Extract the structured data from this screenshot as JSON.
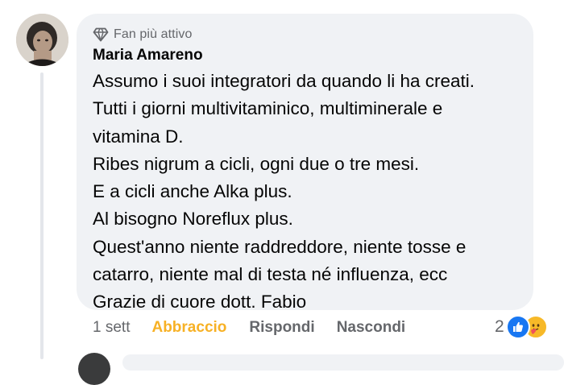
{
  "comment": {
    "badge": {
      "icon": "diamond-icon",
      "label": "Fan più attivo"
    },
    "author": "Maria Amareno",
    "avatar_icon": "user-photo-avatar",
    "lines": [
      "Assumo i suoi integratori da quando li ha creati.",
      "Tutti i giorni multivitaminico, multiminerale e",
      "vitamina D.",
      "Ribes nigrum a cicli, ogni due o tre mesi.",
      "E a cicli anche Alka plus.",
      "Al bisogno Noreflux plus.",
      "Quest'anno niente raddreddore, niente tosse e",
      "catarro, niente mal di testa né influenza, ecc",
      "Grazie di cuore dott. Fabio"
    ]
  },
  "actions": {
    "time": "1 sett",
    "react": "Abbraccio",
    "reply": "Rispondi",
    "hide": "Nascondi"
  },
  "reactions": {
    "count": "2",
    "icons": [
      "like-icon",
      "care-icon"
    ]
  },
  "colors": {
    "bubble_bg": "#f0f2f5",
    "secondary_text": "#65676b",
    "react_active": "#f7b125",
    "like_blue": "#1877f2",
    "care_yellow": "#f7b928",
    "thread_line": "#e4e6eb"
  }
}
